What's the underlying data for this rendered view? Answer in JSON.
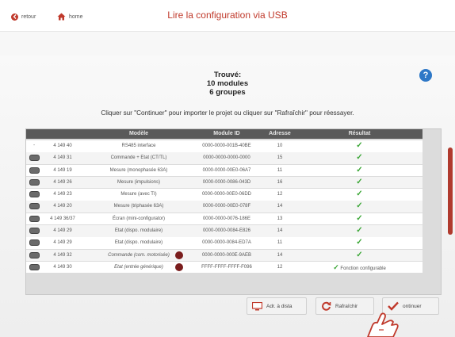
{
  "header": {
    "back_label": "retour",
    "home_label": "home",
    "title": "Lire la configuration via USB"
  },
  "found": {
    "line1": "Trouvé:",
    "line2": "10 modules",
    "line3": "6 groupes"
  },
  "help_label": "?",
  "instruction": "Cliquer sur \"Continuer\" pour importer le projet ou cliquer sur \"Rafraîchir\" pour réessayer.",
  "table": {
    "headers": {
      "model": "Modèle",
      "module_id": "Module ID",
      "address": "Adresse",
      "result": "Résultat"
    },
    "rows": [
      {
        "sel": "-",
        "num": "4 149 40",
        "model": "RS485 interface",
        "id": "0000-0000-001B-40BE",
        "addr": "10",
        "result": "✓",
        "italic": false,
        "dot": false
      },
      {
        "sel": "pill",
        "num": "4 149 31",
        "model": "Commande + Etat (CT/TL)",
        "id": "0000-0000-0000-0000",
        "addr": "15",
        "result": "✓",
        "italic": false,
        "dot": false
      },
      {
        "sel": "pill",
        "num": "4 149 19",
        "model": "Mesure (monophasée 63A)",
        "id": "0000-0000-00E0-06A7",
        "addr": "11",
        "result": "✓",
        "italic": false,
        "dot": false
      },
      {
        "sel": "pill",
        "num": "4 149 26",
        "model": "Mesure (impulsions)",
        "id": "0000-0000-0086-043D",
        "addr": "16",
        "result": "✓",
        "italic": false,
        "dot": false
      },
      {
        "sel": "pill",
        "num": "4 149 23",
        "model": "Mesure (avec TI)",
        "id": "0000-0000-00E0-06DD",
        "addr": "12",
        "result": "✓",
        "italic": false,
        "dot": false
      },
      {
        "sel": "pill",
        "num": "4 149 20",
        "model": "Mesure (triphasée 63A)",
        "id": "0000-0000-00E0-078F",
        "addr": "14",
        "result": "✓",
        "italic": false,
        "dot": false
      },
      {
        "sel": "pill",
        "num": "4 149 36/37",
        "model": "Écran (mini-configurator)",
        "id": "0000-0000-0076-186E",
        "addr": "13",
        "result": "✓",
        "italic": false,
        "dot": false
      },
      {
        "sel": "pill",
        "num": "4 149 29",
        "model": "Etat (dispo. modulaire)",
        "id": "0000-0000-0084-E826",
        "addr": "14",
        "result": "✓",
        "italic": false,
        "dot": false
      },
      {
        "sel": "pill",
        "num": "4 149 29",
        "model": "Etat (dispo. modulaire)",
        "id": "0000-0000-0084-ED7A",
        "addr": "11",
        "result": "✓",
        "italic": false,
        "dot": false
      },
      {
        "sel": "pill",
        "num": "4 149 32",
        "model": "Commande (com. motorisée)",
        "id": "0000-0000-000E-9AEB",
        "addr": "14",
        "result": "✓",
        "italic": true,
        "dot": true
      },
      {
        "sel": "pill",
        "num": "4 149 30",
        "model": "Etat (entrée générique)",
        "id": "FFFF-FFFF-FFFF-F096",
        "addr": "12",
        "result": "✓ Fonction configurable",
        "italic": true,
        "dot": true
      }
    ]
  },
  "buttons": {
    "adr_label": "Adr. à dista",
    "refresh_label": "Rafraîchir",
    "continue_label": "ontinuer"
  },
  "colors": {
    "accent_red": "#c0392b",
    "check_green": "#3aa635",
    "help_blue": "#2e78c7",
    "table_header": "#5a5a5a"
  },
  "icons": [
    "back-icon",
    "home-icon",
    "help-icon",
    "monitor-icon",
    "refresh-icon",
    "check-icon",
    "hand-pointer-icon"
  ]
}
